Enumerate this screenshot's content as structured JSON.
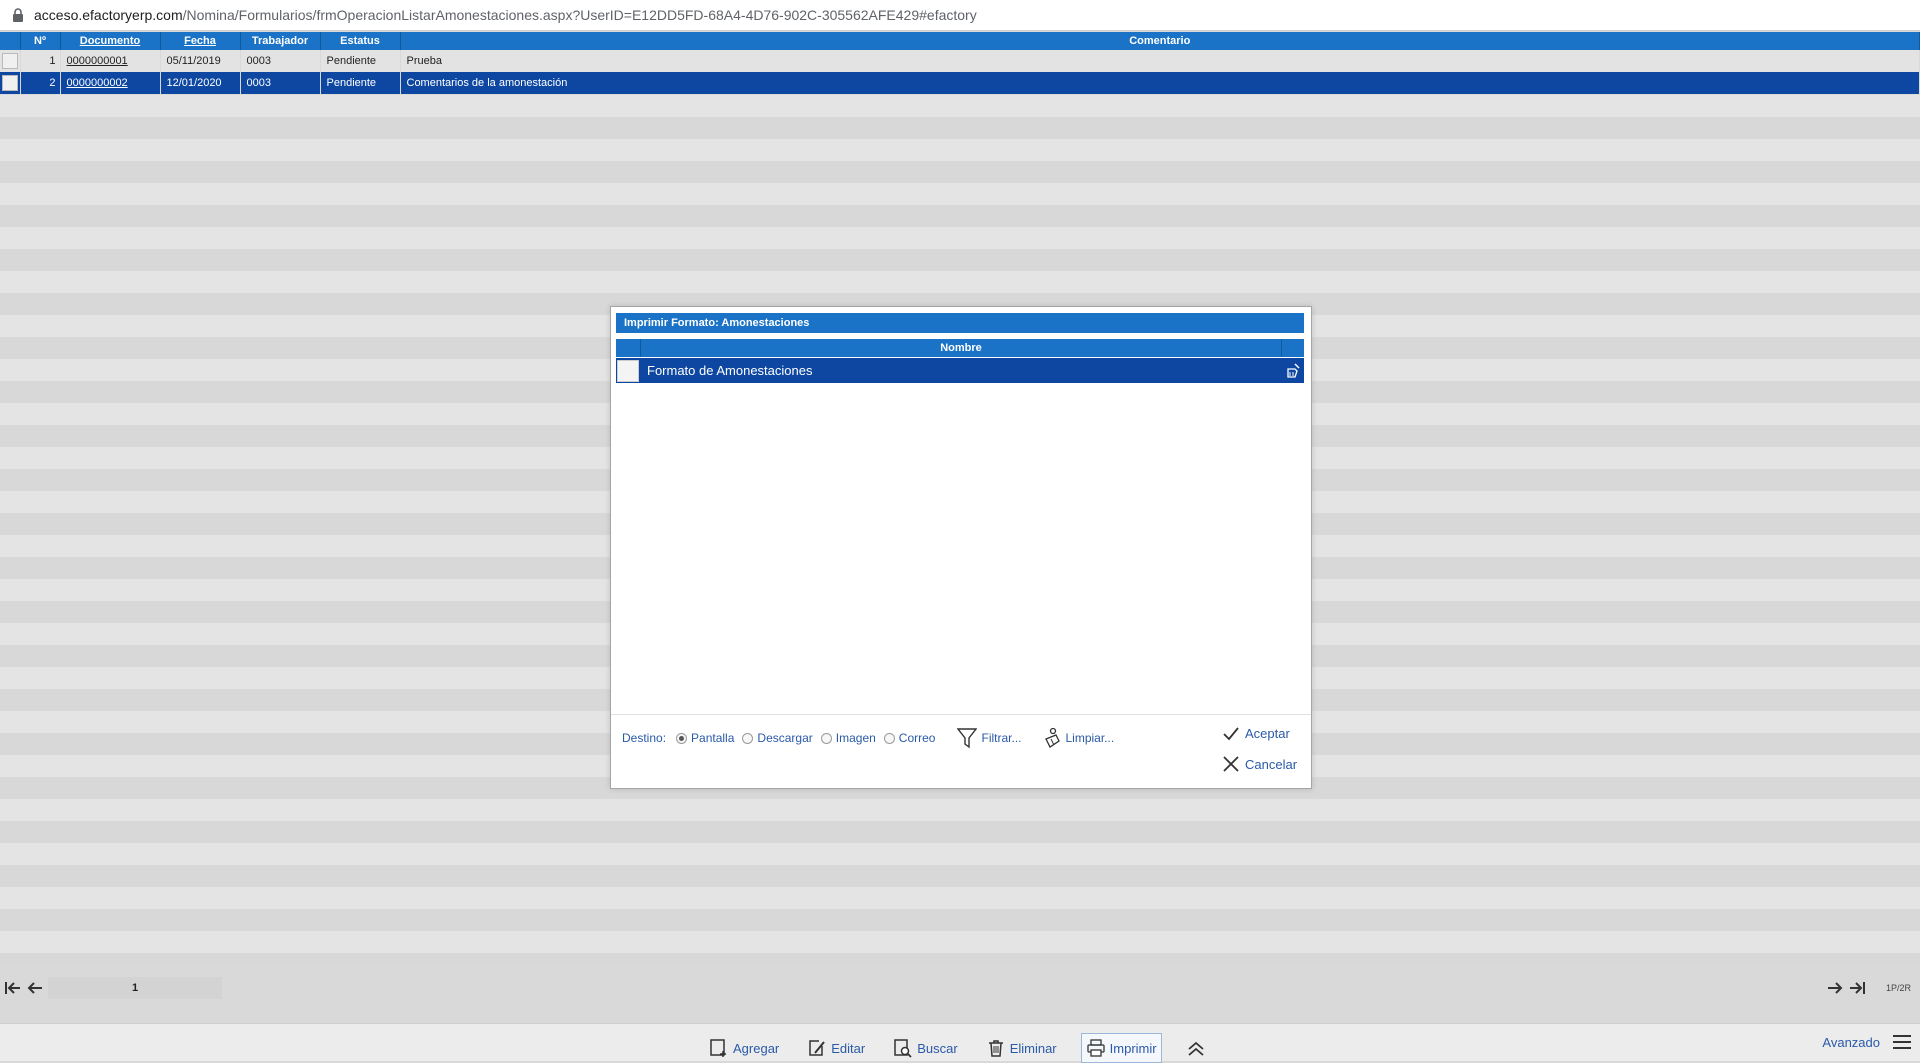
{
  "browser": {
    "url_host": "acceso.efactoryerp.com",
    "url_path": "/Nomina/Formularios/frmOperacionListarAmonestaciones.aspx?UserID=E12DD5FD-68A4-4D76-902C-305562AFE429#efactory"
  },
  "grid": {
    "headers": {
      "num": "Nº",
      "documento": "Documento",
      "fecha": "Fecha",
      "trabajador": "Trabajador",
      "estatus": "Estatus",
      "comentario": "Comentario"
    },
    "rows": [
      {
        "num": "1",
        "documento": "0000000001",
        "fecha": "05/11/2019",
        "trabajador": "0003",
        "estatus": "Pendiente",
        "comentario": "Prueba"
      },
      {
        "num": "2",
        "documento": "0000000002",
        "fecha": "12/01/2020",
        "trabajador": "0003",
        "estatus": "Pendiente",
        "comentario": "Comentarios de la amonestación"
      }
    ]
  },
  "pager": {
    "page": "1",
    "count": "1P/2R"
  },
  "dialog": {
    "title": "Imprimir Formato: Amonestaciones",
    "column_header": "Nombre",
    "items": [
      {
        "name": "Formato de Amonestaciones"
      }
    ],
    "destino_label": "Destino:",
    "options": [
      "Pantalla",
      "Descargar",
      "Imagen",
      "Correo"
    ],
    "selected_option": "Pantalla",
    "filtrar_label": "Filtrar...",
    "limpiar_label": "Limpiar...",
    "aceptar_label": "Aceptar",
    "cancelar_label": "Cancelar"
  },
  "toolbar": {
    "agregar": "Agregar",
    "editar": "Editar",
    "buscar": "Buscar",
    "eliminar": "Eliminar",
    "imprimir": "Imprimir",
    "avanzado": "Avanzado"
  },
  "colors": {
    "header_blue": "#1a73c7",
    "selected_row": "#0d47a1",
    "link_blue": "#2a5aa8"
  }
}
